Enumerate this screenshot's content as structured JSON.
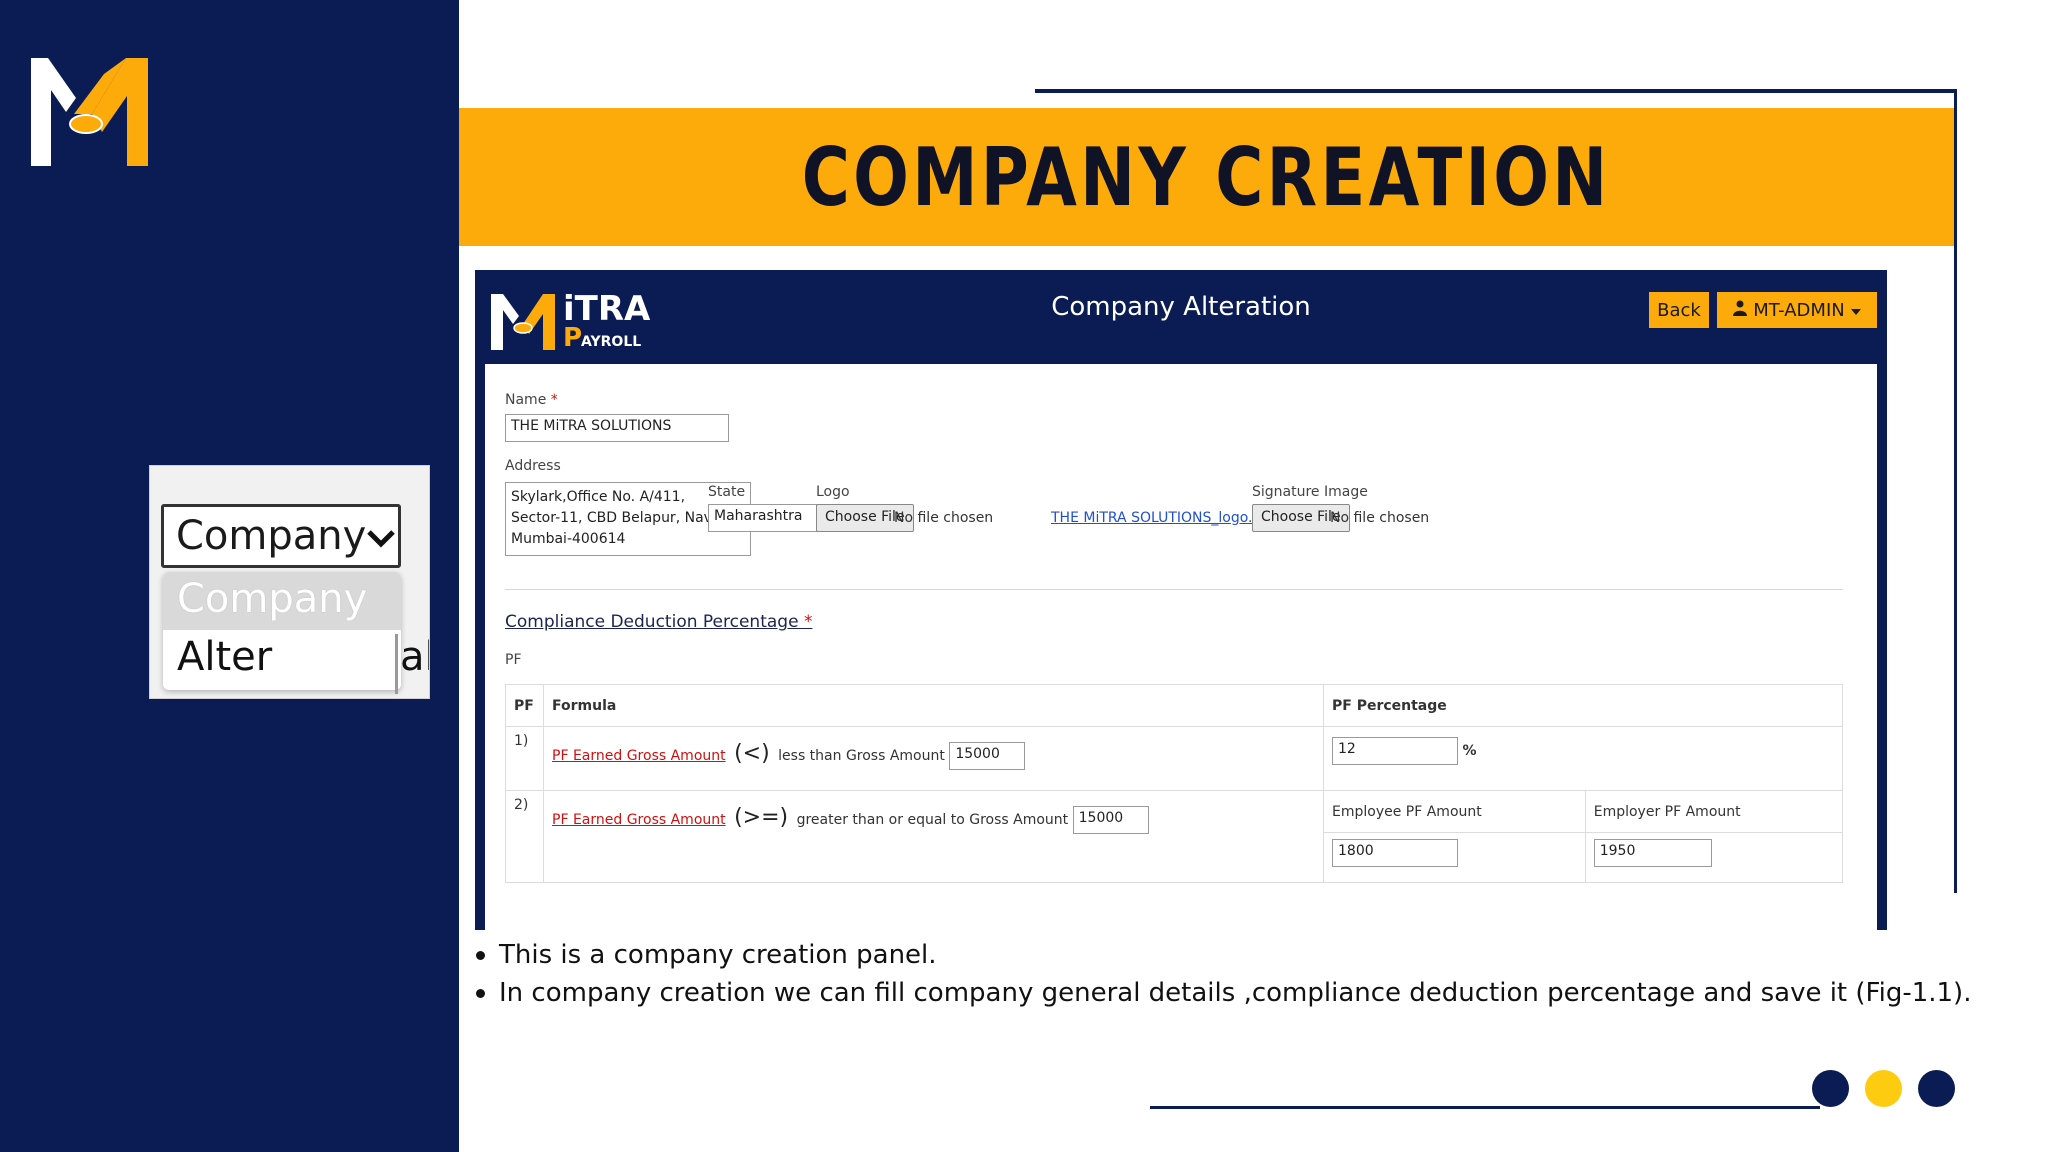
{
  "slide": {
    "title": "COMPANY CREATION",
    "bullets": [
      "This is a company creation panel.",
      "In company creation we can fill company general details ,compliance deduction percentage and save it (Fig-1.1)."
    ]
  },
  "inset": {
    "selected": "Company",
    "options": [
      "Company",
      "Alter"
    ],
    "clipped_text": "al"
  },
  "app": {
    "logo_text_top": "iTRA",
    "logo_text_bottom": "AYROLL",
    "logo_letter": "P",
    "page_title": "Company Alteration",
    "back_label": "Back",
    "user_label": "MT-ADMIN"
  },
  "form": {
    "name_label": "Name",
    "name_value": "THE MiTRA SOLUTIONS",
    "address_label": "Address",
    "address_value": "Skylark,Office No. A/411,\nSector-11, CBD Belapur, Navi\nMumbai-400614",
    "state_label": "State",
    "state_value": "Maharashtra",
    "logo_label": "Logo",
    "choose_file": "Choose File",
    "no_file": "No file chosen",
    "logo_link": "THE MiTRA SOLUTIONS_logo.png",
    "signature_label": "Signature Image",
    "compliance_title": "Compliance Deduction Percentage",
    "pf_label": "PF"
  },
  "pf_table": {
    "headers": [
      "PF",
      "Formula",
      "PF Percentage"
    ],
    "rows": [
      {
        "num": "1)",
        "link": "PF Earned Gross Amount",
        "op": "(<)",
        "text": "less than Gross Amount",
        "amount": "15000",
        "percentage": "12",
        "unit": "%"
      },
      {
        "num": "2)",
        "link": "PF Earned Gross Amount",
        "op": "(>=)",
        "text": "greater than or equal to Gross Amount",
        "amount": "15000",
        "employee_label": "Employee PF Amount",
        "employer_label": "Employer PF Amount",
        "employee_value": "1800",
        "employer_value": "1950"
      }
    ]
  },
  "colors": {
    "navy": "#0b1c54",
    "accent": "#fdab0b",
    "yellow_dot": "#fdcc10"
  }
}
